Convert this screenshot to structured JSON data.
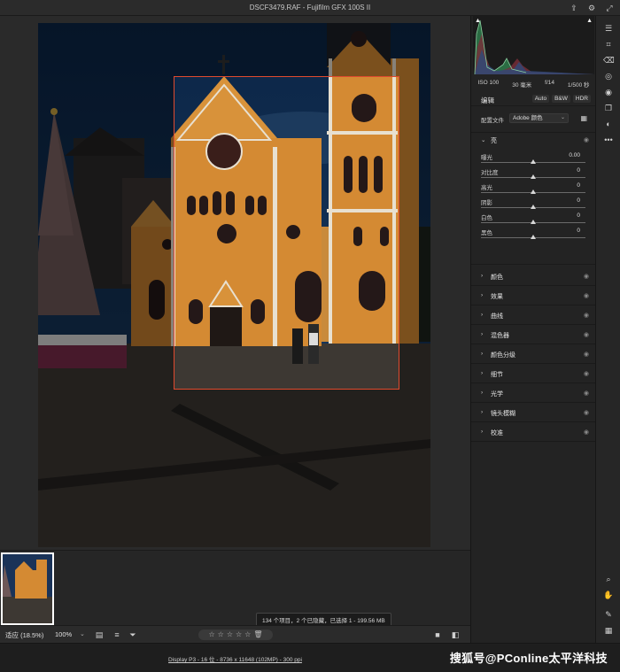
{
  "window": {
    "title": "DSCF3479.RAF - Fujifilm GFX 100S II"
  },
  "titlebar_icons": [
    "export-icon",
    "gear-icon",
    "expand-icon"
  ],
  "camera_info": {
    "iso": "ISO 100",
    "focal": "30 毫米",
    "aperture": "f/14",
    "shutter": "1/500 秒"
  },
  "edit": {
    "title": "编辑",
    "auto": "Auto",
    "bw": "B&W",
    "hdr": "HDR",
    "profile_label": "配置文件",
    "profile_value": "Adobe 颜色"
  },
  "light": {
    "name": "亮",
    "sliders": [
      {
        "label": "曝光",
        "value": "0.00",
        "pos": 0.5
      },
      {
        "label": "对比度",
        "value": "0",
        "pos": 0.5
      },
      {
        "label": "高光",
        "value": "0",
        "pos": 0.5
      },
      {
        "label": "阴影",
        "value": "0",
        "pos": 0.5
      },
      {
        "label": "白色",
        "value": "0",
        "pos": 0.5
      },
      {
        "label": "黑色",
        "value": "0",
        "pos": 0.5
      }
    ]
  },
  "sections": [
    "颜色",
    "效果",
    "曲线",
    "混色器",
    "颜色分级",
    "细节",
    "光学",
    "镜头模糊",
    "校准"
  ],
  "filmstrip": {
    "tooltip": "134 个项目，2 个已隐藏，已选择 1 - 199.56 MB"
  },
  "bottombar": {
    "zoom_fit": "适应 (18.5%)",
    "zoom_pct": "100%",
    "rating_stars": [
      "☆",
      "☆",
      "☆",
      "☆",
      "☆"
    ]
  },
  "status": {
    "info": "Display P3 - 16 位 - 8736 x 11648 (102MP) - 300 ppi",
    "watermark": "搜狐号@PConline太平洋科技"
  },
  "colors": {
    "crop": "#e04a2e",
    "building": "#d48a33",
    "sky": "#0f2c52"
  }
}
